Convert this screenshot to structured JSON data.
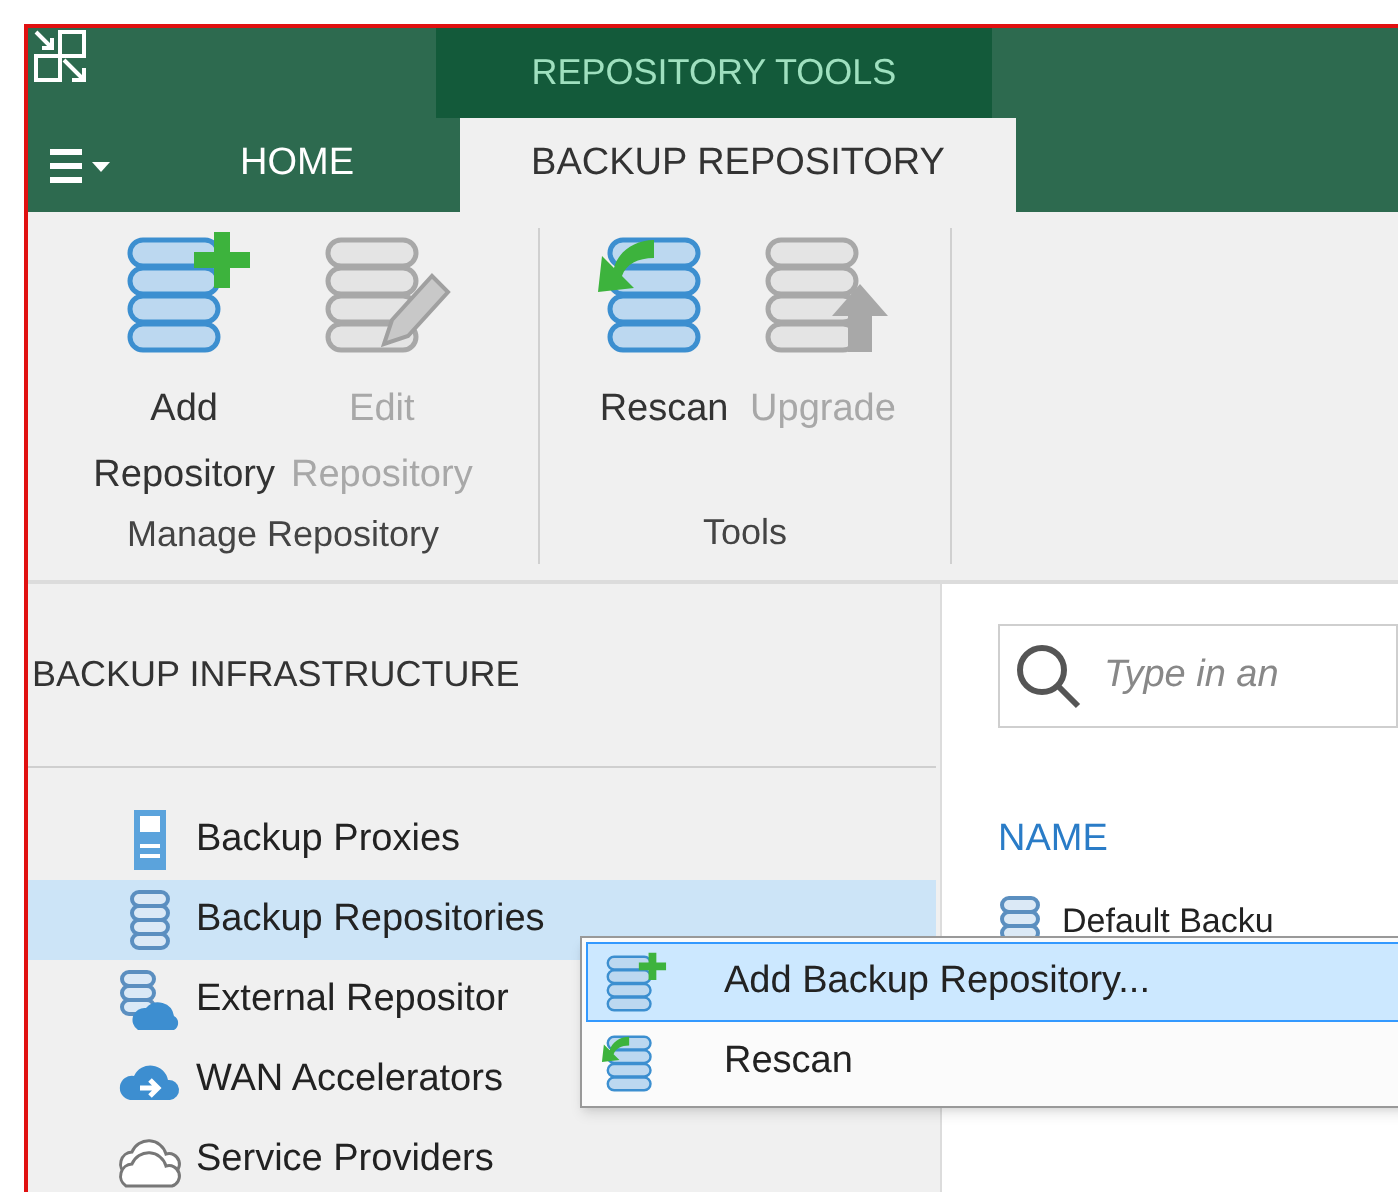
{
  "title_bar": {
    "context_tab": "REPOSITORY TOOLS"
  },
  "tabs": [
    {
      "label": "HOME",
      "selected": false
    },
    {
      "label": "BACKUP REPOSITORY",
      "selected": true
    }
  ],
  "ribbon": {
    "groups": [
      {
        "label": "Manage Repository",
        "buttons": [
          {
            "label_lines": [
              "Add",
              "Repository"
            ],
            "kind": "add",
            "disabled": false
          },
          {
            "label_lines": [
              "Edit",
              "Repository"
            ],
            "kind": "edit",
            "disabled": true
          }
        ]
      },
      {
        "label": "Tools",
        "buttons": [
          {
            "label_lines": [
              "Rescan"
            ],
            "kind": "rescan",
            "disabled": false
          },
          {
            "label_lines": [
              "Upgrade"
            ],
            "kind": "upgrade",
            "disabled": true
          }
        ]
      }
    ]
  },
  "sidebar": {
    "title": "BACKUP INFRASTRUCTURE",
    "items": [
      {
        "label": "Backup Proxies",
        "kind": "proxy",
        "selected": false
      },
      {
        "label": "Backup Repositories",
        "kind": "repository",
        "selected": true
      },
      {
        "label": "External Repositor",
        "kind": "external",
        "selected": false
      },
      {
        "label": "WAN Accelerators",
        "kind": "wan",
        "selected": false
      },
      {
        "label": "Service Providers",
        "kind": "provider",
        "selected": false
      }
    ]
  },
  "search": {
    "placeholder": "Type in an"
  },
  "table": {
    "columns": [
      "NAME"
    ],
    "rows": [
      {
        "name": "Default Backu"
      }
    ]
  },
  "context_menu": {
    "items": [
      {
        "label": "Add Backup Repository...",
        "kind": "add",
        "selected": true
      },
      {
        "label": "Rescan",
        "kind": "rescan",
        "selected": false
      }
    ]
  }
}
